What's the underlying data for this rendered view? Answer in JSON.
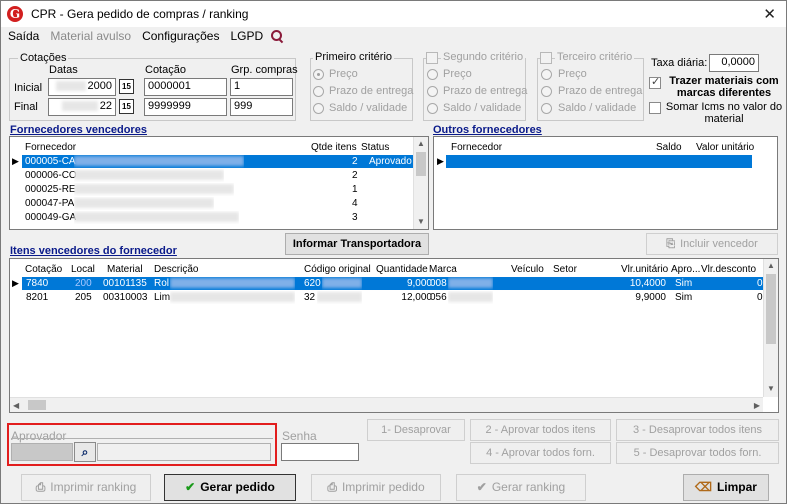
{
  "window": {
    "title": "CPR - Gera pedido de compras / ranking",
    "close": "✕",
    "logo_letter": "G"
  },
  "menu": {
    "items": [
      "Saída",
      "Material avulso",
      "Configurações",
      "LGPD"
    ]
  },
  "cotacoes": {
    "group_label": "Cotações",
    "col_datas": "Datas",
    "col_cotacao": "Cotação",
    "col_grp": "Grp. compras",
    "inicial_label": "Inicial",
    "final_label": "Final",
    "inicial_data_suffix": "2000",
    "final_data_suffix": "22",
    "calendar_icon": "15",
    "inicial_cotacao": "0000001",
    "final_cotacao": "9999999",
    "inicial_grp": "1",
    "final_grp": "999"
  },
  "criterios": {
    "primeiro": {
      "title": "Primeiro critério",
      "options": [
        "Preço",
        "Prazo de entrega",
        "Saldo / validade"
      ]
    },
    "segundo": {
      "title": "Segundo critério",
      "options": [
        "Preço",
        "Prazo de entrega",
        "Saldo / validade"
      ]
    },
    "terceiro": {
      "title": "Terceiro critério",
      "options": [
        "Preço",
        "Prazo de entrega",
        "Saldo / validade"
      ]
    }
  },
  "taxa": {
    "label": "Taxa diária:",
    "value": "0,0000"
  },
  "options": {
    "trazer_label": "Trazer materiais com marcas diferentes",
    "somar_label": "Somar Icms no valor do material"
  },
  "fornecedores_vencedores": {
    "title": "Fornecedores vencedores",
    "columns": [
      "Fornecedor",
      "Qtde itens",
      "Status"
    ],
    "rows": [
      {
        "fornecedor": "000005-CA",
        "qtde": "2",
        "status": "Aprovado"
      },
      {
        "fornecedor": "000006-CO",
        "qtde": "2",
        "status": ""
      },
      {
        "fornecedor": "000025-RE",
        "qtde": "1",
        "status": ""
      },
      {
        "fornecedor": "000047-PA",
        "qtde": "4",
        "status": ""
      },
      {
        "fornecedor": "000049-GA",
        "qtde": "3",
        "status": ""
      }
    ]
  },
  "outros_fornecedores": {
    "title": "Outros fornecedores",
    "columns": [
      "Fornecedor",
      "Saldo",
      "Valor unitário"
    ]
  },
  "buttons": {
    "informar_transportadora": "Informar Transportadora",
    "incluir_vencedor": "Incluir vencedor",
    "desaprovar": "1- Desaprovar",
    "aprovar_todos_itens": "2 - Aprovar todos itens",
    "desaprovar_todos_itens": "3 - Desaprovar todos itens",
    "aprovar_todos_forn": "4 - Aprovar todos forn.",
    "desaprovar_todos_forn": "5 - Desaprovar todos forn.",
    "imprimir_ranking": "Imprimir ranking",
    "gerar_pedido": "Gerar pedido",
    "imprimir_pedido": "Imprimir pedido",
    "gerar_ranking": "Gerar ranking",
    "limpar": "Limpar"
  },
  "itens": {
    "title": "Itens vencedores do fornecedor",
    "columns": [
      "Cotação",
      "Local",
      "Material",
      "Descrição",
      "Código original",
      "Quantidade",
      "Marca",
      "Veículo",
      "Setor",
      "Vlr.unitário",
      "Apro...",
      "Vlr.desconto"
    ],
    "rows": [
      {
        "cotacao": "7840",
        "local": "200",
        "material": "00101135",
        "descricao": "Rol",
        "codigo": "620",
        "quantidade": "9,000",
        "marca": "008",
        "veiculo": "",
        "setor": "",
        "vlr_unitario": "10,4000",
        "aprovado": "Sim",
        "vlr_desconto": "0"
      },
      {
        "cotacao": "8201",
        "local": "205",
        "material": "00310003",
        "descricao": "Lim",
        "codigo": "32",
        "quantidade": "12,000",
        "marca": "056",
        "veiculo": "",
        "setor": "",
        "vlr_unitario": "9,9000",
        "aprovado": "Sim",
        "vlr_desconto": "0"
      }
    ]
  },
  "aprovador": {
    "label": "Aprovador",
    "senha_label": "Senha"
  },
  "colors": {
    "accent": "#0078d7",
    "section": "#0a1a8a",
    "highlight_box": "#e21d1d",
    "logo": "#d21f1f"
  },
  "icons": {
    "search": "search-icon",
    "calendar": "calendar-icon",
    "binoculars": "binoculars-icon",
    "check": "check-icon",
    "printer": "printer-icon",
    "broom": "broom-icon"
  }
}
